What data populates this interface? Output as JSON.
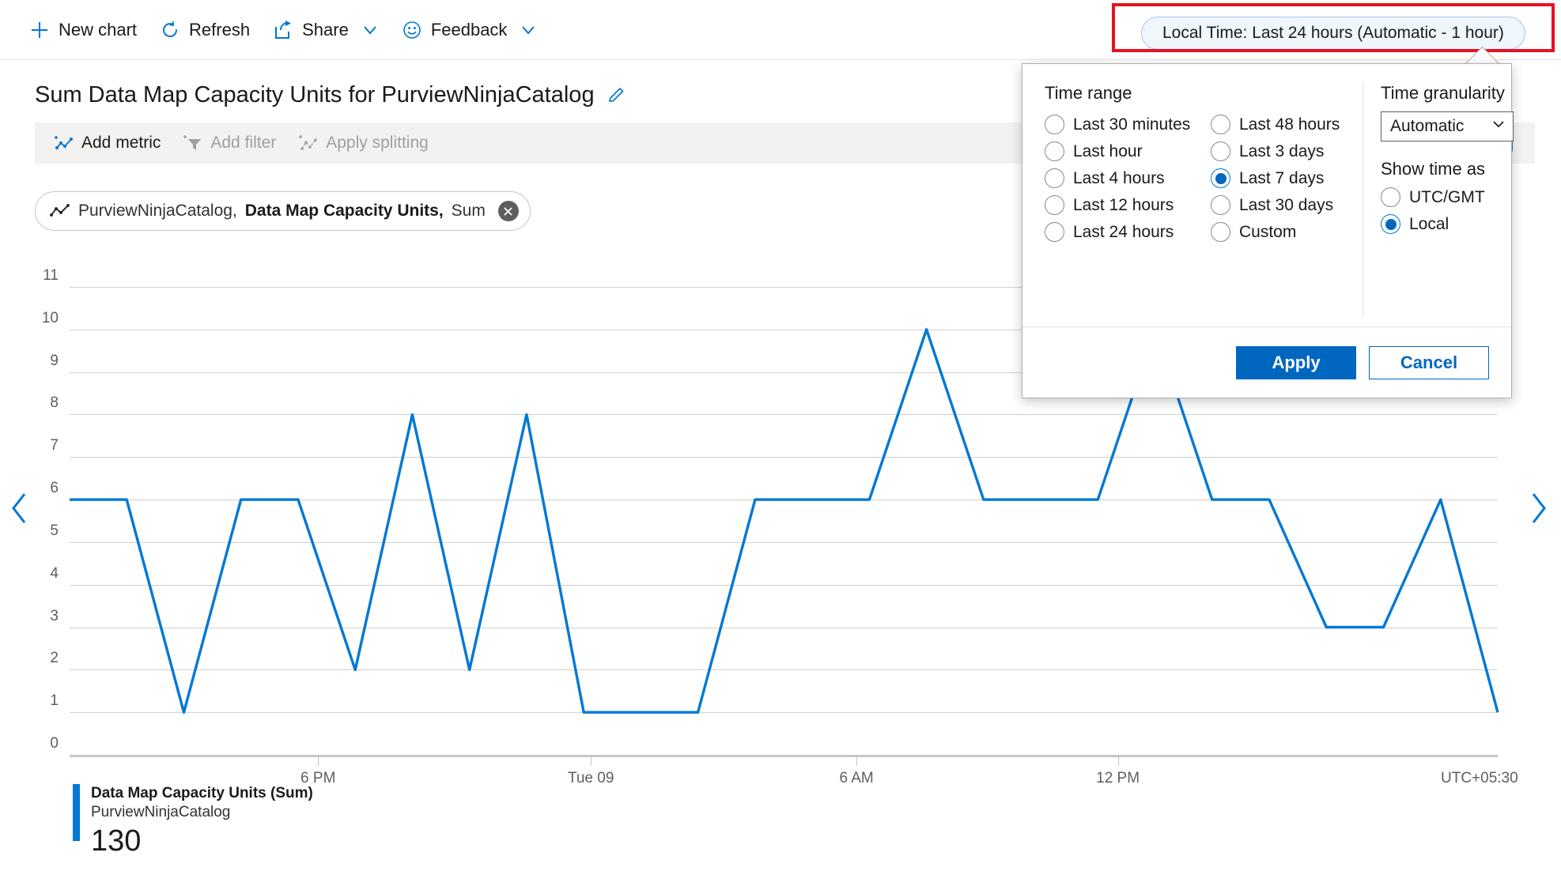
{
  "commandbar": {
    "items": [
      {
        "label": "New chart",
        "icon": "plus-icon",
        "chevron": false
      },
      {
        "label": "Refresh",
        "icon": "refresh-icon",
        "chevron": false
      },
      {
        "label": "Share",
        "icon": "share-icon",
        "chevron": true
      },
      {
        "label": "Feedback",
        "icon": "smiley-icon",
        "chevron": true
      }
    ]
  },
  "chart": {
    "title": "Sum Data Map Capacity Units for PurviewNinjaCatalog",
    "edit_icon": "pencil-icon",
    "toolbar": {
      "add_metric": "Add metric",
      "add_filter": "Add filter",
      "apply_splitting": "Apply splitting",
      "chart_type": "Line chart",
      "share_doc_icon": "document-link-icon"
    },
    "metric_chip": {
      "resource": "PurviewNinjaCatalog,",
      "metric": "Data Map Capacity Units,",
      "aggregation": "Sum",
      "close_icon": "close-icon"
    },
    "legend": {
      "metric": "Data Map Capacity Units (Sum)",
      "resource": "PurviewNinjaCatalog",
      "value": "130",
      "color": "#0078d4"
    },
    "pager": {
      "prev_icon": "chevron-left-icon",
      "next_icon": "chevron-right-icon"
    }
  },
  "timepill": {
    "label": "Local Time: Last 24 hours (Automatic - 1 hour)",
    "highlight_color": "#e81123"
  },
  "timepicker": {
    "time_range_heading": "Time range",
    "options_left": [
      "Last 30 minutes",
      "Last hour",
      "Last 4 hours",
      "Last 12 hours",
      "Last 24 hours"
    ],
    "options_right": [
      "Last 48 hours",
      "Last 3 days",
      "Last 7 days",
      "Last 30 days",
      "Custom"
    ],
    "selected_range": "Last 7 days",
    "granularity_heading": "Time granularity",
    "granularity_value": "Automatic",
    "granularity_chevron": "chevron-down-icon",
    "show_time_heading": "Show time as",
    "show_time_options": [
      "UTC/GMT",
      "Local"
    ],
    "selected_show_time": "Local",
    "apply_label": "Apply",
    "cancel_label": "Cancel"
  },
  "chart_data": {
    "type": "line",
    "title": "Sum Data Map Capacity Units for PurviewNinjaCatalog",
    "xlabel": "",
    "ylabel": "",
    "ylim": [
      0,
      11
    ],
    "yticks": [
      0,
      1,
      2,
      3,
      4,
      5,
      6,
      7,
      8,
      9,
      10,
      11
    ],
    "xticks": [
      "6 PM",
      "Tue 09",
      "6 AM",
      "12 PM"
    ],
    "xtick_positions": [
      0.174,
      0.365,
      0.551,
      0.734
    ],
    "timezone_label": "UTC+05:30",
    "grid": true,
    "legend_position": "bottom-left",
    "series": [
      {
        "name": "Data Map Capacity Units (Sum)",
        "color": "#0078d4",
        "total": 130,
        "values": [
          6,
          6,
          1,
          6,
          6,
          2,
          8,
          2,
          8,
          1,
          1,
          1,
          6,
          6,
          6,
          10,
          6,
          6,
          6,
          10,
          6,
          6,
          3,
          3,
          6,
          1
        ],
        "projected_tail": true,
        "projected_from_index": 25
      }
    ]
  }
}
